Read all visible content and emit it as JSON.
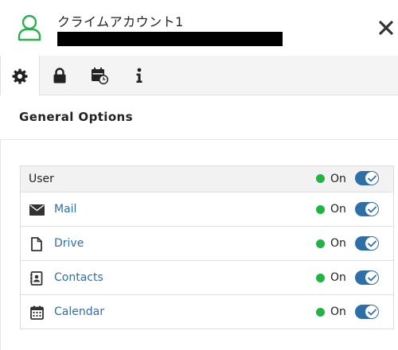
{
  "account": {
    "name": "クライムアカウント1"
  },
  "colors": {
    "accent_green": "#27b34b",
    "toggle_blue": "#2f6fa7",
    "status_on": "#1fb542",
    "icon_dark": "#333333"
  },
  "tabs": [
    {
      "icon": "gear-icon",
      "active": true
    },
    {
      "icon": "lock-icon",
      "active": false
    },
    {
      "icon": "calendar-clock-icon",
      "active": false
    },
    {
      "icon": "info-icon",
      "active": false
    }
  ],
  "section": {
    "title": "General Options"
  },
  "options": [
    {
      "label": "User",
      "icon": null,
      "status": "On",
      "enabled": true
    },
    {
      "label": "Mail",
      "icon": "mail-icon",
      "status": "On",
      "enabled": true
    },
    {
      "label": "Drive",
      "icon": "file-icon",
      "status": "On",
      "enabled": true
    },
    {
      "label": "Contacts",
      "icon": "address-book-icon",
      "status": "On",
      "enabled": true
    },
    {
      "label": "Calendar",
      "icon": "calendar-icon",
      "status": "On",
      "enabled": true
    }
  ]
}
